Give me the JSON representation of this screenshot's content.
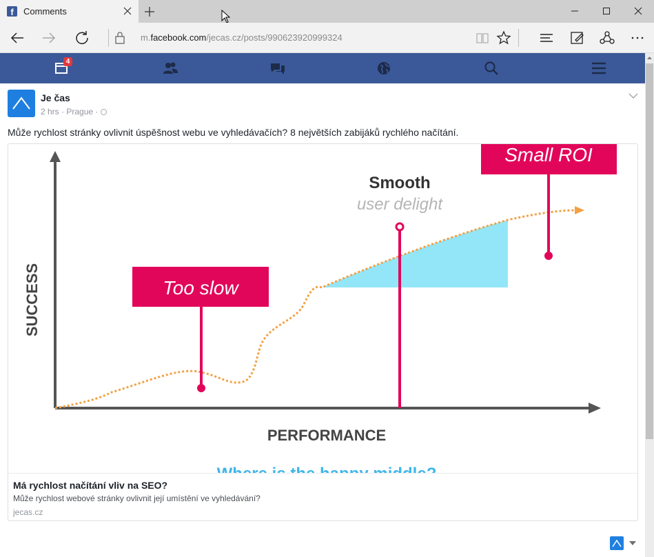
{
  "browser": {
    "tab_title": "Comments",
    "tab_favicon_letter": "f",
    "url_prefix": "m.",
    "url_host": "facebook.com",
    "url_path": "/jecas.cz/posts/990623920999324",
    "icons": {
      "back": "back-arrow-icon",
      "forward": "forward-arrow-icon",
      "refresh": "refresh-icon",
      "lock": "lock-icon",
      "reading_view": "book-icon",
      "favorite": "star-icon",
      "hub": "hub-icon",
      "web_note": "pen-note-icon",
      "share": "share-icon",
      "more": "more-icon"
    }
  },
  "fbnav": {
    "notification_count": "4",
    "bg_color": "#3b5998",
    "items": [
      "news-feed-icon",
      "friends-icon",
      "messages-icon",
      "globe-icon",
      "search-icon",
      "menu-icon"
    ]
  },
  "post": {
    "author": "Je čas",
    "time": "2 hrs",
    "separator": "·",
    "location": "Prague",
    "text": "Může rychlost stránky ovlivnit úspěšnost webu ve vyhledávačích? 8 největších zabijáků rychlého načítání.",
    "link": {
      "title": "Má rychlost načítání vliv na SEO?",
      "description": "Může rychlost webové stránky ovlivnit její umístění ve vyhledávání?",
      "domain": "jecas.cz"
    },
    "image": {
      "y_axis_label": "SUCCESS",
      "x_axis_label": "PERFORMANCE",
      "label_too_slow": "Too slow",
      "label_small_roi": "Small ROI",
      "label_smooth": "Smooth",
      "label_user_delight": "user delight",
      "caption_partial": "Where is the happy middle?",
      "accent_color": "#e2065a",
      "curve_color": "#f2a144",
      "fill_color": "#93e6f7"
    }
  }
}
